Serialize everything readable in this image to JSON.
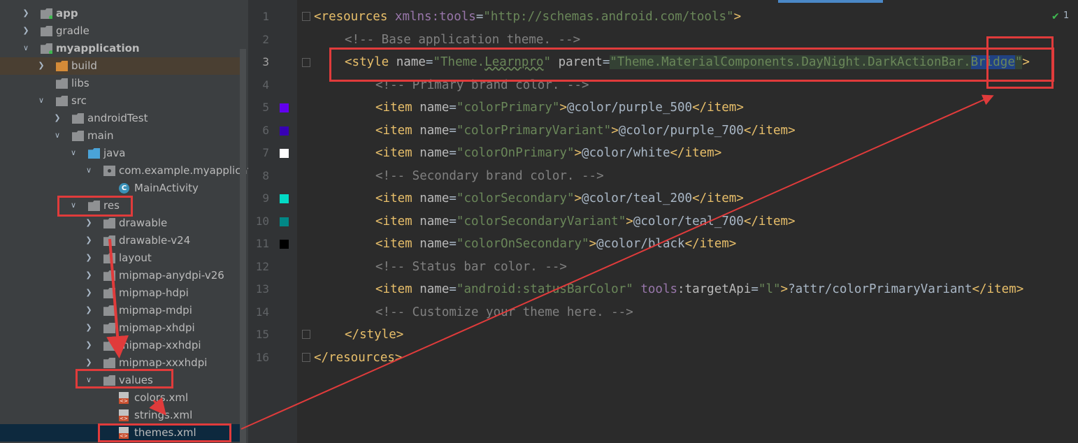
{
  "project_tree": {
    "items": [
      {
        "label": "app",
        "icon": "module-folder-icon",
        "arrow": "collapsed",
        "bold": true
      },
      {
        "label": "gradle",
        "icon": "folder-icon",
        "arrow": "collapsed"
      },
      {
        "label": "myapplication",
        "icon": "module-folder-icon",
        "arrow": "expanded",
        "bold": true
      },
      {
        "label": "build",
        "icon": "orange-folder-icon",
        "arrow": "collapsed"
      },
      {
        "label": "libs",
        "icon": "folder-icon",
        "arrow": "none"
      },
      {
        "label": "src",
        "icon": "folder-icon",
        "arrow": "expanded"
      },
      {
        "label": "androidTest",
        "icon": "folder-icon",
        "arrow": "collapsed"
      },
      {
        "label": "main",
        "icon": "folder-icon",
        "arrow": "expanded"
      },
      {
        "label": "java",
        "icon": "blue-folder-icon",
        "arrow": "expanded"
      },
      {
        "label": "com.example.myapplicati",
        "icon": "package-icon",
        "arrow": "expanded"
      },
      {
        "label": "MainActivity",
        "icon": "class-icon",
        "arrow": "none"
      },
      {
        "label": "res",
        "icon": "res-folder-icon",
        "arrow": "expanded"
      },
      {
        "label": "drawable",
        "icon": "folder-icon",
        "arrow": "collapsed"
      },
      {
        "label": "drawable-v24",
        "icon": "folder-icon",
        "arrow": "collapsed"
      },
      {
        "label": "layout",
        "icon": "folder-icon",
        "arrow": "collapsed"
      },
      {
        "label": "mipmap-anydpi-v26",
        "icon": "folder-icon",
        "arrow": "collapsed"
      },
      {
        "label": "mipmap-hdpi",
        "icon": "folder-icon",
        "arrow": "collapsed"
      },
      {
        "label": "mipmap-mdpi",
        "icon": "folder-icon",
        "arrow": "collapsed"
      },
      {
        "label": "mipmap-xhdpi",
        "icon": "folder-icon",
        "arrow": "collapsed"
      },
      {
        "label": "mipmap-xxhdpi",
        "icon": "folder-icon",
        "arrow": "collapsed"
      },
      {
        "label": "mipmap-xxxhdpi",
        "icon": "folder-icon",
        "arrow": "collapsed"
      },
      {
        "label": "values",
        "icon": "folder-icon",
        "arrow": "expanded"
      },
      {
        "label": "colors.xml",
        "icon": "xml-file-icon",
        "arrow": "none"
      },
      {
        "label": "strings.xml",
        "icon": "xml-file-icon",
        "arrow": "none"
      },
      {
        "label": "themes.xml",
        "icon": "xml-file-icon",
        "arrow": "none",
        "selected": true
      }
    ]
  },
  "editor": {
    "status_count": "1",
    "line_numbers": [
      "1",
      "2",
      "3",
      "4",
      "5",
      "6",
      "7",
      "8",
      "9",
      "10",
      "11",
      "12",
      "13",
      "14",
      "15",
      "16"
    ],
    "swatch_colors": {
      "l5": "#6200ee",
      "l6": "#3700b3",
      "l7": "#ffffff",
      "l9": "#03dac5",
      "l10": "#018786",
      "l11": "#000000"
    },
    "lines": {
      "l1": {
        "t1": "<resources ",
        "t2": "xmlns:",
        "t3": "tools",
        "t4": "=",
        "t5": "\"http://schemas.android.com/tools\"",
        "t6": ">"
      },
      "l2": {
        "t1": "<!-- Base application theme. -->"
      },
      "l3": {
        "t1": "<style ",
        "t2": "name",
        "t3": "=",
        "t4": "\"Theme.",
        "t5": "Learnpro",
        "t6": "\"",
        "t7": " parent",
        "t8": "=",
        "t9": "\"Theme.MaterialComponents.DayNight.DarkActionBar.",
        "t10": "Bridge",
        "t11": "\"",
        "t12": ">"
      },
      "l4": {
        "t1": "<!-- Primary brand color. -->"
      },
      "l5": {
        "t1": "<item ",
        "t2": "name",
        "t3": "=",
        "t4": "\"colorPrimary\"",
        "t5": ">",
        "t6": "@color/purple_500",
        "t7": "</item>"
      },
      "l6": {
        "t1": "<item ",
        "t2": "name",
        "t3": "=",
        "t4": "\"colorPrimaryVariant\"",
        "t5": ">",
        "t6": "@color/purple_700",
        "t7": "</item>"
      },
      "l7": {
        "t1": "<item ",
        "t2": "name",
        "t3": "=",
        "t4": "\"colorOnPrimary\"",
        "t5": ">",
        "t6": "@color/white",
        "t7": "</item>"
      },
      "l8": {
        "t1": "<!-- Secondary brand color. -->"
      },
      "l9": {
        "t1": "<item ",
        "t2": "name",
        "t3": "=",
        "t4": "\"colorSecondary\"",
        "t5": ">",
        "t6": "@color/teal_200",
        "t7": "</item>"
      },
      "l10": {
        "t1": "<item ",
        "t2": "name",
        "t3": "=",
        "t4": "\"colorSecondaryVariant\"",
        "t5": ">",
        "t6": "@color/teal_700",
        "t7": "</item>"
      },
      "l11": {
        "t1": "<item ",
        "t2": "name",
        "t3": "=",
        "t4": "\"colorOnSecondary\"",
        "t5": ">",
        "t6": "@color/black",
        "t7": "</item>"
      },
      "l12": {
        "t1": "<!-- Status bar color. -->"
      },
      "l13": {
        "t1": "<item ",
        "t2": "name",
        "t3": "=",
        "t4": "\"android:statusBarColor\"",
        "t5": " tools",
        "t6": ":targetApi",
        "t7": "=",
        "t8": "\"l\"",
        "t9": ">",
        "t10": "?attr/colorPrimaryVariant",
        "t11": "</item>"
      },
      "l14": {
        "t1": "<!-- Customize your theme here. -->"
      },
      "l15": {
        "t1": "</style>"
      },
      "l16": {
        "t1": "</resources>"
      }
    }
  }
}
